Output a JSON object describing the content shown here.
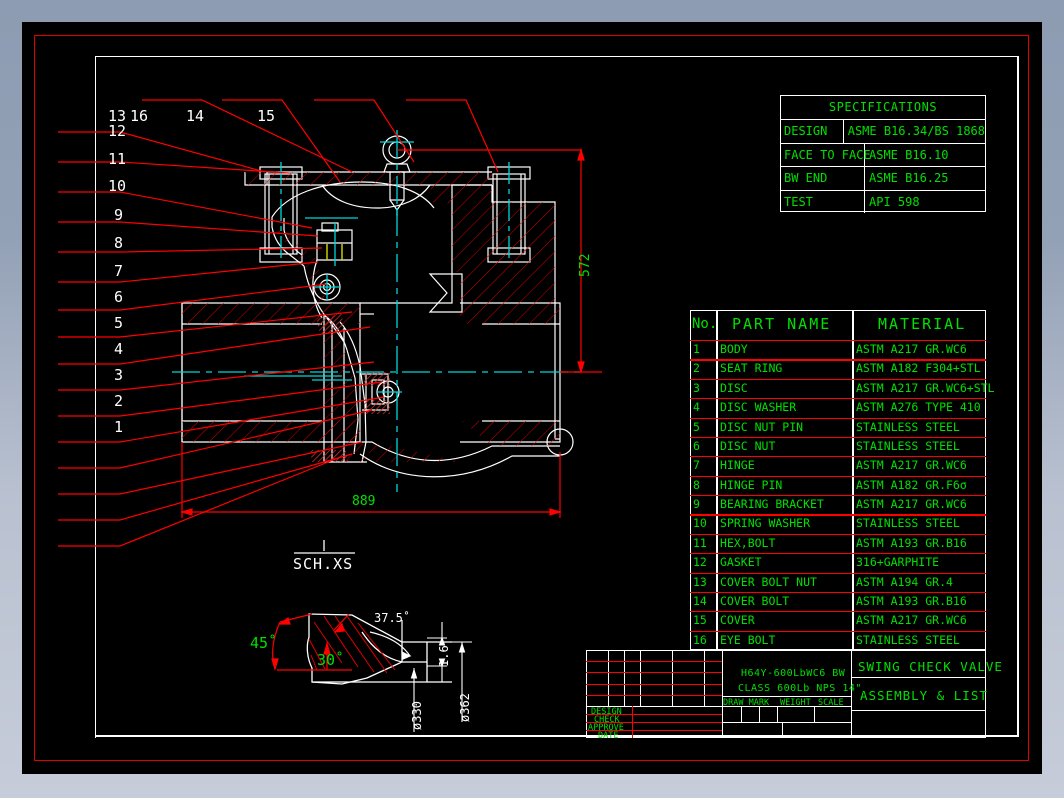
{
  "sheet": {
    "background": "#000000",
    "border_color": "#ff0000",
    "frame_color": "#ffffff",
    "green": "#00e000",
    "cyan": "#00d7d7"
  },
  "balloons": [
    "16",
    "15",
    "14",
    "13",
    "12",
    "11",
    "10",
    "9",
    "8",
    "7",
    "6",
    "5",
    "4",
    "3",
    "2",
    "1"
  ],
  "specifications": {
    "title": "SPECIFICATIONS",
    "rows": [
      {
        "label": "DESIGN",
        "value": "ASME B16.34/BS 1868"
      },
      {
        "label": "FACE TO FACE",
        "value": "ASME B16.10"
      },
      {
        "label": "BW END",
        "value": "ASME B16.25"
      },
      {
        "label": "TEST",
        "value": "API 598"
      }
    ]
  },
  "parts_list": {
    "headers": {
      "no": "No.",
      "part_name": "PART NAME",
      "material": "MATERIAL"
    },
    "rows": [
      {
        "no": "1",
        "part_name": "BODY",
        "material": "ASTM A217 GR.WC6"
      },
      {
        "no": "2",
        "part_name": "SEAT RING",
        "material": "ASTM A182 F304+STL"
      },
      {
        "no": "3",
        "part_name": "DISC",
        "material": "ASTM A217 GR.WC6+STL"
      },
      {
        "no": "4",
        "part_name": "DISC WASHER",
        "material": "ASTM A276 TYPE 410"
      },
      {
        "no": "5",
        "part_name": "DISC NUT PIN",
        "material": "STAINLESS STEEL"
      },
      {
        "no": "6",
        "part_name": "DISC NUT",
        "material": "STAINLESS STEEL"
      },
      {
        "no": "7",
        "part_name": "HINGE",
        "material": "ASTM A217 GR.WC6"
      },
      {
        "no": "8",
        "part_name": "HINGE PIN",
        "material": "ASTM A182 GR.F6σ"
      },
      {
        "no": "9",
        "part_name": "BEARING BRACKET",
        "material": "ASTM A217 GR.WC6"
      },
      {
        "no": "10",
        "part_name": "SPRING WASHER",
        "material": "STAINLESS STEEL"
      },
      {
        "no": "11",
        "part_name": "HEX,BOLT",
        "material": "ASTM A193 GR.B16"
      },
      {
        "no": "12",
        "part_name": "GASKET",
        "material": "316+GARPHITE"
      },
      {
        "no": "13",
        "part_name": "COVER BOLT NUT",
        "material": "ASTM A194 GR.4"
      },
      {
        "no": "14",
        "part_name": "COVER BOLT",
        "material": "ASTM A193 GR.B16"
      },
      {
        "no": "15",
        "part_name": "COVER",
        "material": "ASTM A217 GR.WC6"
      },
      {
        "no": "16",
        "part_name": "EYE BOLT",
        "material": "STAINLESS STEEL"
      }
    ]
  },
  "title_block": {
    "approval_rows": [
      "DESIGN",
      "CHECK",
      "APPROVE",
      "DATE"
    ],
    "drawing_code_line1": "H64Y-600LbWC6 BW",
    "drawing_code_line2": "CLASS 600Lb NPS 14\"",
    "columns": [
      "DRAW MARK",
      "WEIGHT",
      "SCALE"
    ],
    "title_line1": "SWING CHECK VALVE",
    "title_line2": "ASSEMBLY & LIST"
  },
  "dimensions": {
    "overall_length": "889",
    "overall_height": "572",
    "weld_note_top": "I",
    "weld_note": "SCH.XS",
    "angle_45": "45˚",
    "angle_30": "30˚",
    "angle_375": "37.5˚",
    "land_16": "1.6",
    "dia_330": "ø330",
    "dia_362": "ø362"
  }
}
